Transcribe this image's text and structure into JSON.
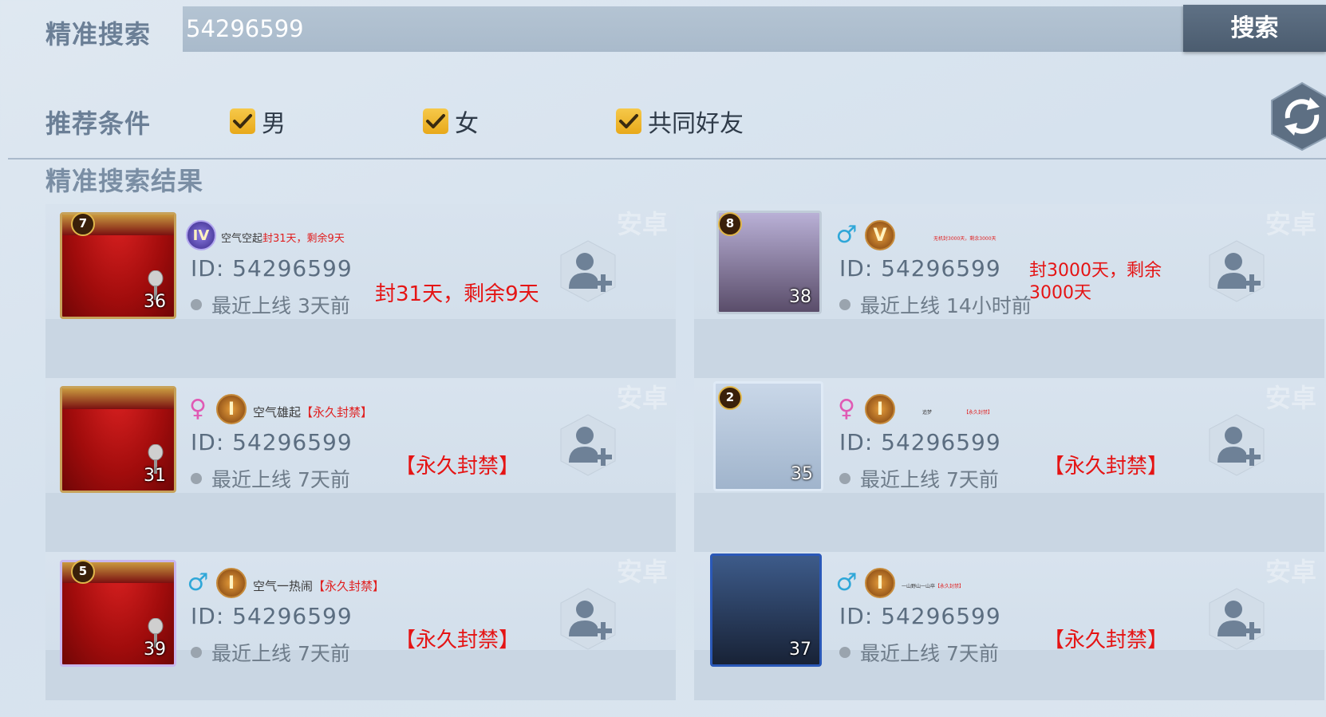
{
  "search": {
    "label": "精准搜索",
    "value": "54296599",
    "button": "搜索"
  },
  "filters": {
    "label": "推荐条件",
    "options": [
      {
        "label": "男",
        "checked": true
      },
      {
        "label": "女",
        "checked": true
      },
      {
        "label": "共同好友",
        "checked": true
      }
    ]
  },
  "results": {
    "title": "精准搜索结果",
    "watermark": "安卓",
    "cards": [
      {
        "badge": "7",
        "level": "36",
        "gender": "",
        "rank": "IV",
        "nickname": "空气空起",
        "nick_ban": "封31天，剩余9天",
        "id": "ID: 54296599",
        "online": "最近上线 3天前",
        "ban": "封31天，剩余9天"
      },
      {
        "badge": "8",
        "level": "38",
        "gender": "♂",
        "rank": "V",
        "nickname": "",
        "nick_ban": "无机封3000天，剩余3000天",
        "id": "ID: 54296599",
        "online": "最近上线 14小时前",
        "ban": "封3000天，剩余3000天"
      },
      {
        "badge": "",
        "level": "31",
        "gender": "♀",
        "rank": "I",
        "nickname": "空气雄起",
        "nick_ban": "【永久封禁】",
        "id": "ID: 54296599",
        "online": "最近上线 7天前",
        "ban": "【永久封禁】"
      },
      {
        "badge": "2",
        "level": "35",
        "gender": "♀",
        "rank": "I",
        "nickname": "追梦",
        "nick_ban": "【永久封禁】",
        "id": "ID: 54296599",
        "online": "最近上线 7天前",
        "ban": "【永久封禁】"
      },
      {
        "badge": "5",
        "level": "39",
        "gender": "♂",
        "rank": "I",
        "nickname": "空气一热闹",
        "nick_ban": "【永久封禁】",
        "id": "ID: 54296599",
        "online": "最近上线 7天前",
        "ban": "【永久封禁】"
      },
      {
        "badge": "",
        "level": "37",
        "gender": "♂",
        "rank": "I",
        "nickname": "一山野山一山卒",
        "nick_ban": "【永久封禁】",
        "id": "ID: 54296599",
        "online": "最近上线 7天前",
        "ban": "【永久封禁】"
      }
    ]
  },
  "icons": {
    "checkbox": "checkmark-icon",
    "refresh": "refresh-icon",
    "add_friend": "add-friend-icon",
    "male": "male-icon",
    "female": "female-icon"
  },
  "colors": {
    "accent_checkbox": "#f0b830",
    "ban_red": "#e51414",
    "search_button": "#55677a",
    "male": "#2fa7d8",
    "female": "#e05ab4"
  }
}
